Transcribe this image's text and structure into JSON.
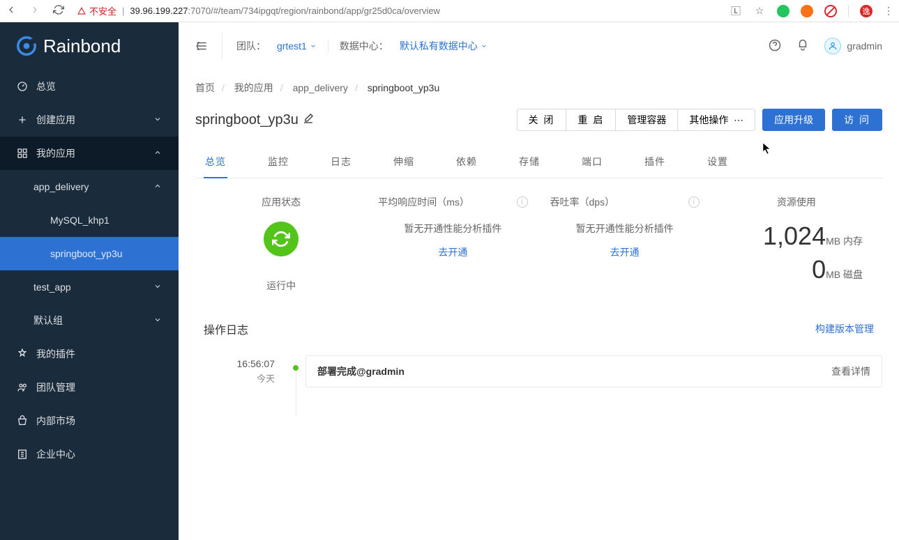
{
  "browser": {
    "insecure_label": "不安全",
    "url_host": "39.96.199.227",
    "url_rest": ":7070/#/team/734ipgqt/region/rainbond/app/gr25d0ca/overview"
  },
  "sidebar": {
    "logo": "Rainbond",
    "overview": "总览",
    "create_app": "创建应用",
    "my_apps": "我的应用",
    "groups": {
      "app_delivery": "app_delivery",
      "mysql": "MySQL_khp1",
      "springboot": "springboot_yp3u",
      "test_app": "test_app",
      "default_group": "默认组"
    },
    "my_plugins": "我的插件",
    "team_mgmt": "团队管理",
    "internal_market": "内部市场",
    "enterprise_center": "企业中心"
  },
  "topbar": {
    "team_label": "团队：",
    "team_value": "grtest1",
    "dc_label": "数据中心：",
    "dc_value": "默认私有数据中心",
    "username": "gradmin"
  },
  "breadcrumb": {
    "home": "首页",
    "my_apps": "我的应用",
    "group": "app_delivery",
    "app": "springboot_yp3u"
  },
  "page_title": "springboot_yp3u",
  "actions": {
    "close": "关 闭",
    "restart": "重 启",
    "manage_container": "管理容器",
    "other_ops": "其他操作",
    "app_upgrade": "应用升级",
    "visit": "访 问"
  },
  "tabs": {
    "overview": "总览",
    "monitor": "监控",
    "log": "日志",
    "scale": "伸缩",
    "depend": "依赖",
    "storage": "存储",
    "port": "端口",
    "plugin": "插件",
    "settings": "设置"
  },
  "stats": {
    "app_status_label": "应用状态",
    "app_status_value": "运行中",
    "avg_response_label": "平均响应时间（ms）",
    "no_perf_plugin": "暂无开通性能分析插件",
    "go_enable": "去开通",
    "throughput_label": "吞吐率（dps）",
    "resource_label": "资源使用",
    "memory_value": "1,024",
    "memory_unit": "MB 内存",
    "disk_value": "0",
    "disk_unit": "MB 磁盘"
  },
  "oplog": {
    "header": "操作日志",
    "build_link": "构建版本管理",
    "time": "16:56:07",
    "date": "今天",
    "message": "部署完成@gradmin",
    "detail_btn": "查看详情"
  }
}
